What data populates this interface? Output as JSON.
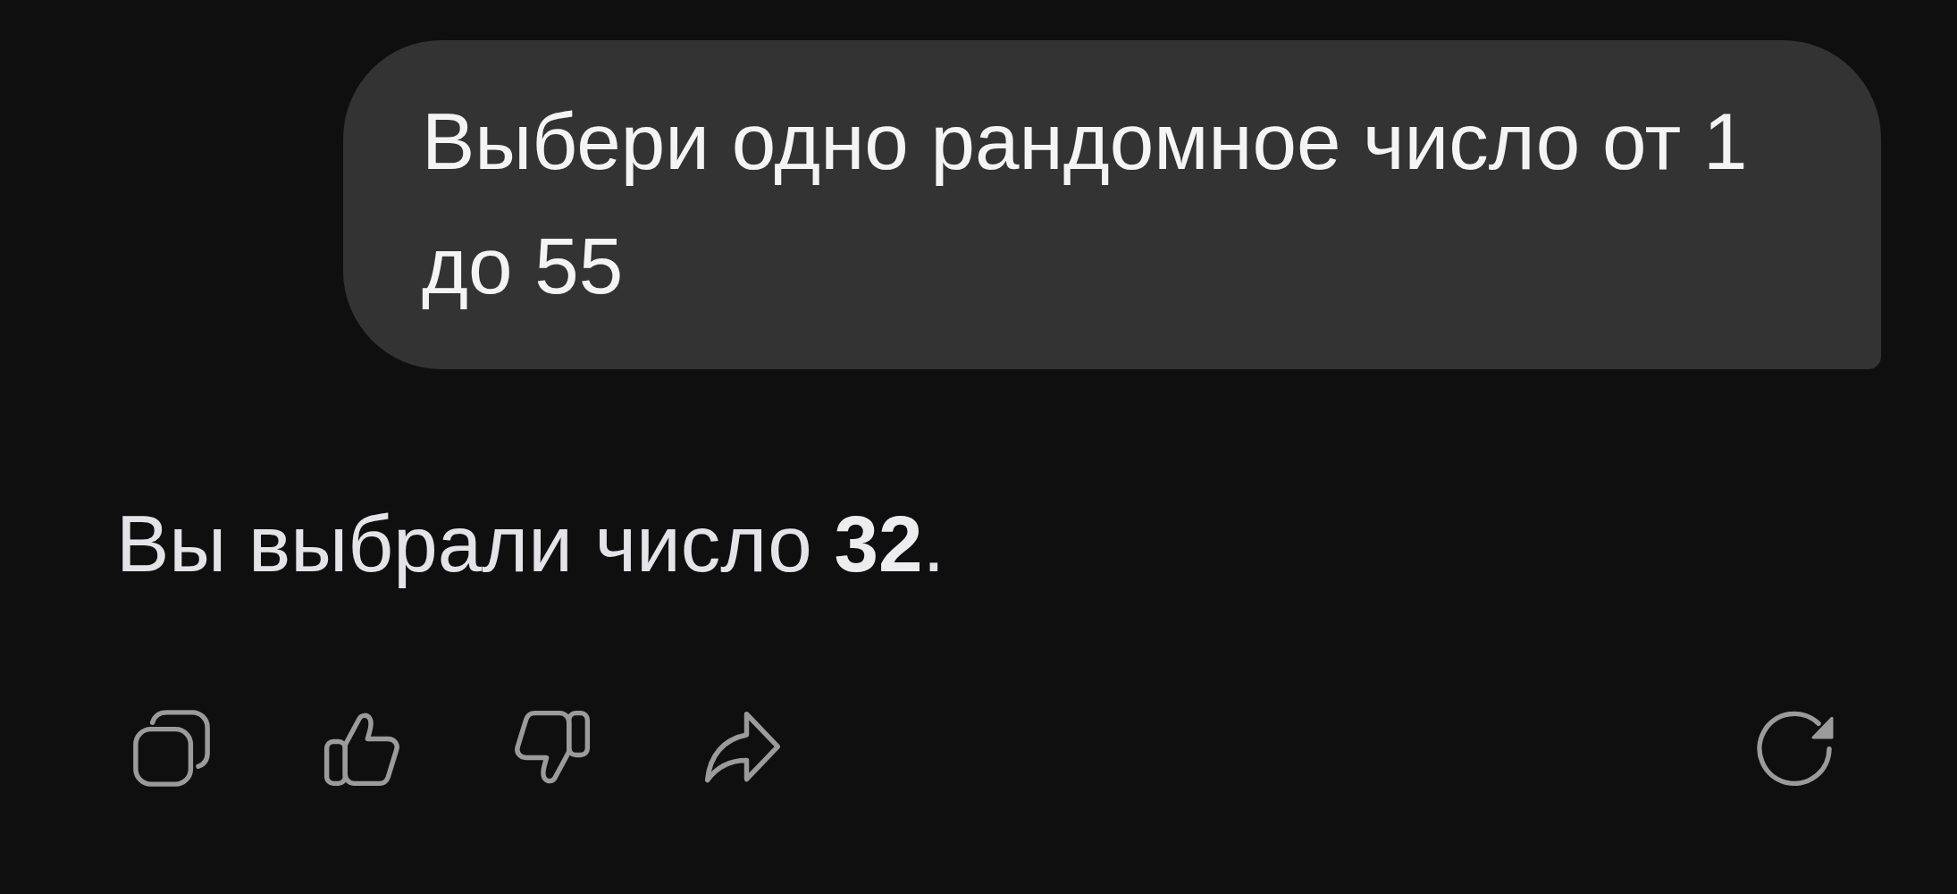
{
  "user_message": {
    "text": "Выбери одно рандомное число от 1 до 55"
  },
  "assistant_message": {
    "text": "Вы выбрали число **32**."
  }
}
